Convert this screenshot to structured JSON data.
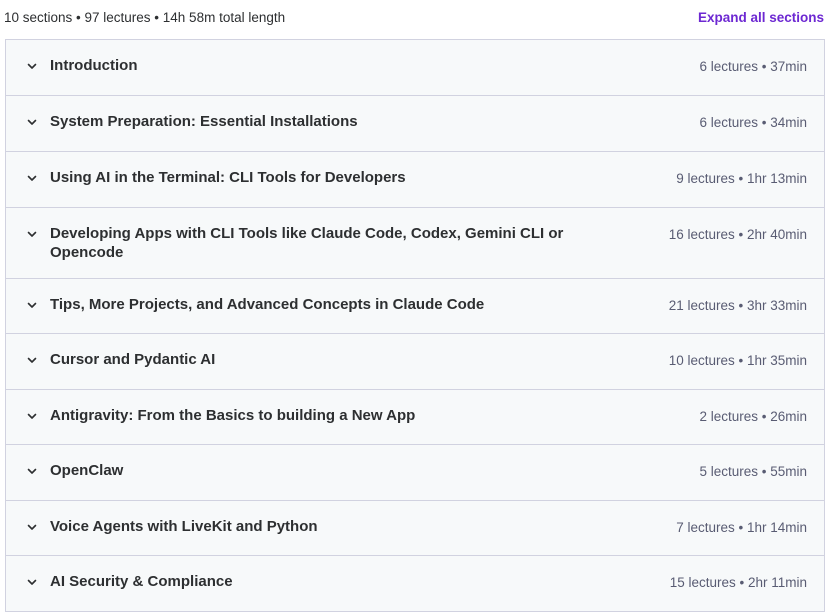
{
  "summary": "10 sections • 97 lectures • 14h 58m total length",
  "expand_label": "Expand all sections",
  "sections": [
    {
      "title": "Introduction",
      "meta": "6 lectures • 37min"
    },
    {
      "title": "System Preparation: Essential Installations",
      "meta": "6 lectures • 34min"
    },
    {
      "title": "Using AI in the Terminal: CLI Tools for Developers",
      "meta": "9 lectures • 1hr 13min"
    },
    {
      "title": "Developing Apps with CLI Tools like Claude Code, Codex, Gemini CLI or Opencode",
      "meta": "16 lectures • 2hr 40min"
    },
    {
      "title": "Tips, More Projects, and Advanced Concepts in Claude Code",
      "meta": "21 lectures • 3hr 33min"
    },
    {
      "title": "Cursor and Pydantic AI",
      "meta": "10 lectures • 1hr 35min"
    },
    {
      "title": "Antigravity: From the Basics to building a New App",
      "meta": "2 lectures • 26min"
    },
    {
      "title": "OpenClaw",
      "meta": "5 lectures • 55min"
    },
    {
      "title": "Voice Agents with LiveKit and Python",
      "meta": "7 lectures • 1hr 14min"
    },
    {
      "title": "AI Security & Compliance",
      "meta": "15 lectures • 2hr 11min"
    }
  ],
  "icons": {
    "chevron": "chevron-down-icon"
  },
  "colors": {
    "accent": "#6d28d2",
    "row_bg": "#f7f9fa",
    "border": "#d1d2e0"
  }
}
